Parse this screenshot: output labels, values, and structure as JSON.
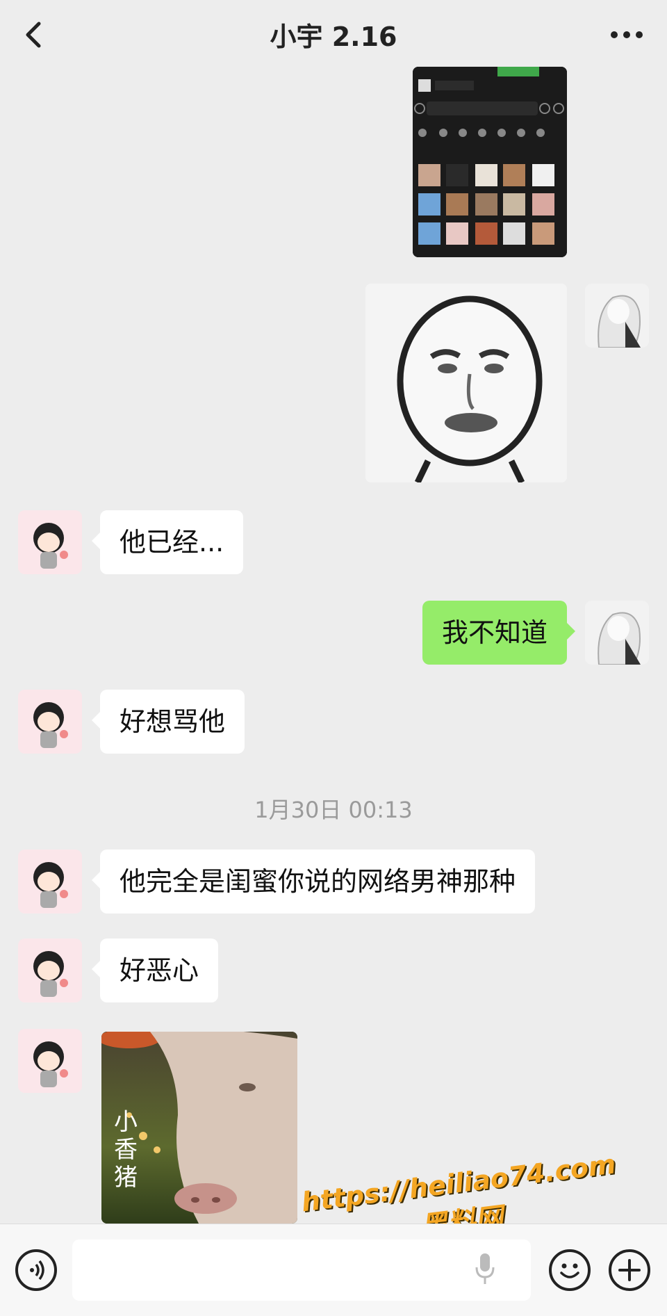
{
  "header": {
    "title": "小宇 2.16",
    "back_icon": "chevron-left-icon",
    "more_icon": "more-dots-icon"
  },
  "messages": [
    {
      "side": "right",
      "type": "image",
      "content": "screenshot of sticker panel"
    },
    {
      "side": "right",
      "type": "image",
      "content": "meme face sticker"
    },
    {
      "side": "left",
      "type": "text",
      "text": "他已经..."
    },
    {
      "side": "right",
      "type": "text",
      "text": "我不知道"
    },
    {
      "side": "left",
      "type": "text",
      "text": "好想骂他"
    },
    {
      "side": "left",
      "type": "text",
      "text": "他完全是闺蜜你说的网络男神那种"
    },
    {
      "side": "left",
      "type": "text",
      "text": "好恶心"
    },
    {
      "side": "left",
      "type": "image",
      "caption": "小香猪"
    }
  ],
  "timestamp": "1月30日 00:13",
  "input_bar": {
    "voice_icon": "voice-icon",
    "mic_icon": "mic-icon",
    "emoji_icon": "emoji-icon",
    "plus_icon": "plus-icon"
  },
  "watermark": {
    "url": "https://heiliao74.com",
    "name": "黑料网"
  },
  "colors": {
    "background": "#ededed",
    "sent_bubble": "#95ec69",
    "received_bubble": "#ffffff",
    "timestamp": "#9a9a9a",
    "watermark": "#f4a623"
  }
}
